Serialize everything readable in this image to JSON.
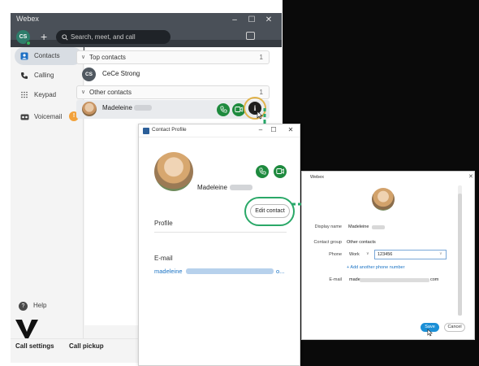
{
  "app": {
    "title": "Webex",
    "window_controls": [
      "–",
      "☐",
      "✕"
    ],
    "avatar_initials": "CS"
  },
  "toolbar": {
    "search_placeholder": "Search, meet, and call",
    "plus_label": "+"
  },
  "sidebar": {
    "items": [
      {
        "label": "Contacts",
        "icon": "contacts-icon"
      },
      {
        "label": "Calling",
        "icon": "phone-icon"
      },
      {
        "label": "Keypad",
        "icon": "keypad-icon"
      },
      {
        "label": "Voicemail",
        "icon": "voicemail-icon",
        "badge": "!"
      }
    ],
    "help_label": "Help"
  },
  "bottom_bar": {
    "call_settings": "Call settings",
    "call_pickup": "Call pickup"
  },
  "contacts": {
    "groups": [
      {
        "label": "Top contacts",
        "count": "1",
        "entries": [
          {
            "initials": "CS",
            "name": "CeCe Strong"
          }
        ]
      },
      {
        "label": "Other contacts",
        "count": "1",
        "entries": [
          {
            "name": "Madeleine"
          }
        ]
      }
    ]
  },
  "profile_window": {
    "title": "Contact Profile",
    "controls": [
      "–",
      "☐",
      "✕"
    ],
    "name": "Madeleine",
    "edit_button": "Edit contact",
    "section_label": "Profile",
    "email_label": "E-mail",
    "email_value_start": "madeleine",
    "email_value_end": "o..."
  },
  "edit_dialog": {
    "title": "Webex",
    "close": "✕",
    "display_name_label": "Display name",
    "display_name_value": "Madeleine",
    "contact_group_label": "Contact group",
    "contact_group_value": "Other contacts",
    "phone_label": "Phone",
    "phone_type": "Work",
    "phone_value": "123456",
    "add_phone": "+ Add another phone number",
    "email_label": "E-mail",
    "email_value_start": "made",
    "email_value_end": "com",
    "save_button": "Save",
    "cancel_button": "Cancel"
  },
  "colors": {
    "accent_green": "#1e8a3e",
    "highlight_ring": "#e0b24a",
    "edit_ring": "#2aa868",
    "save_blue": "#1b8fd6",
    "link_blue": "#1a73c4"
  }
}
